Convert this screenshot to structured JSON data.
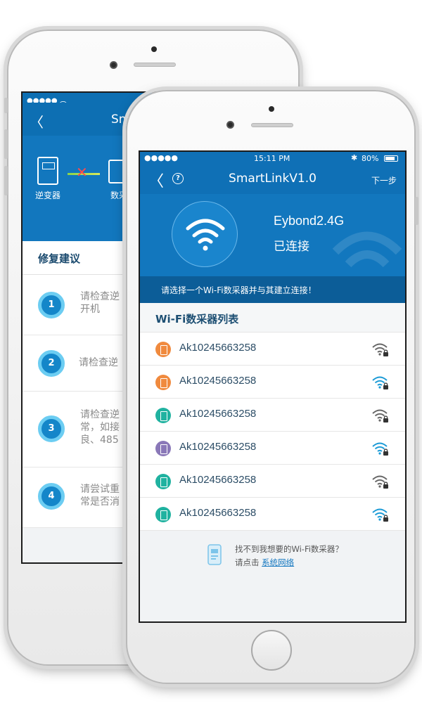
{
  "back_screen": {
    "nav_title": "Sm",
    "hero": {
      "inverter_label": "逆变器",
      "collector_label": "数采器"
    },
    "section_title": "修复建议",
    "steps": [
      {
        "num": "1",
        "text_line1": "请检查逆",
        "text_line2": "开机"
      },
      {
        "num": "2",
        "text_line1": "请检查逆",
        "text_line2": ""
      },
      {
        "num": "3",
        "text_line1": "请检查逆",
        "text_line2": "常，如接",
        "text_line3": "良、485"
      },
      {
        "num": "4",
        "text_line1": "请尝试重",
        "text_line2": "常是否消"
      }
    ]
  },
  "front_screen": {
    "status_bar": {
      "signal": "●●●●●",
      "time": "15:11 PM",
      "bluetooth": "✱",
      "battery_pct": "80%",
      "battery_level": 0.8
    },
    "nav": {
      "title": "SmartLinkV1.0",
      "next_label": "下一步",
      "help_glyph": "?"
    },
    "hero": {
      "network_name": "Eybond2.4G",
      "status": "已连接"
    },
    "tip": "请选择一个Wi-Fi数采器并与其建立连接！",
    "list_title": "Wi-Fi数采器列表",
    "devices": [
      {
        "name": "Ak10245663258",
        "icon_color": "#f08a3e",
        "signal_color": "#666666"
      },
      {
        "name": "Ak10245663258",
        "icon_color": "#f08a3e",
        "signal_color": "#1a9ad6"
      },
      {
        "name": "Ak10245663258",
        "icon_color": "#20b2a0",
        "signal_color": "#666666"
      },
      {
        "name": "Ak10245663258",
        "icon_color": "#8a78b8",
        "signal_color": "#1a9ad6"
      },
      {
        "name": "Ak10245663258",
        "icon_color": "#20b2a0",
        "signal_color": "#666666"
      },
      {
        "name": "Ak10245663258",
        "icon_color": "#20b2a0",
        "signal_color": "#1a9ad6"
      }
    ],
    "help": {
      "line1": "找不到我想要的Wi-Fi数采器？",
      "line2_prefix": "请点击",
      "line2_link": "系统网络"
    }
  }
}
